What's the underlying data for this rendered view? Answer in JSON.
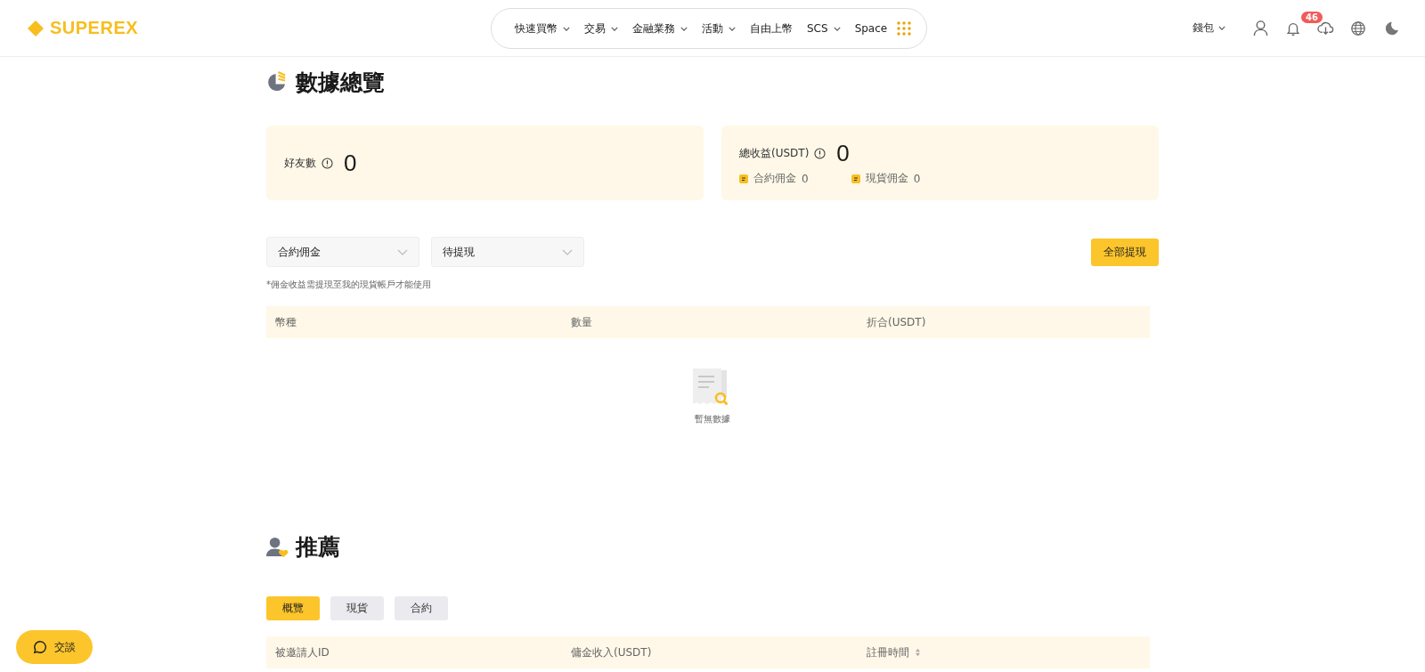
{
  "header": {
    "logo": "SUPEREX",
    "nav": [
      {
        "label": "快速買幣",
        "dropdown": true
      },
      {
        "label": "交易",
        "dropdown": true
      },
      {
        "label": "金融業務",
        "dropdown": true
      },
      {
        "label": "活動",
        "dropdown": true
      },
      {
        "label": "自由上幣",
        "dropdown": false
      },
      {
        "label": "SCS",
        "dropdown": true
      },
      {
        "label": "Space",
        "dropdown": false
      }
    ],
    "wallet": {
      "label": "錢包",
      "dropdown": true
    },
    "notification_count": "46"
  },
  "overview": {
    "title": "數據總覽",
    "friends": {
      "label": "好友數",
      "value": "0"
    },
    "earnings": {
      "label": "總收益(USDT)",
      "value": "0",
      "items": [
        {
          "label": "合約佣金",
          "value": "0"
        },
        {
          "label": "現貨佣金",
          "value": "0"
        }
      ]
    },
    "filters": [
      {
        "value": "合約佣金"
      },
      {
        "value": "待提現"
      }
    ],
    "withdraw_button": "全部提現",
    "note": "*佣金收益需提現至我的現貨帳戶才能使用",
    "table": {
      "columns": [
        "幣種",
        "數量",
        "折合(USDT)"
      ],
      "empty_text": "暫無數據"
    }
  },
  "referral": {
    "title": "推薦",
    "tabs": [
      {
        "label": "概覽",
        "selected": true
      },
      {
        "label": "現貨",
        "selected": false
      },
      {
        "label": "合約",
        "selected": false
      }
    ],
    "table": {
      "columns": [
        {
          "label": "被邀請人ID",
          "sortable": false
        },
        {
          "label": "傭金收入(USDT)",
          "sortable": false
        },
        {
          "label": "註冊時間",
          "sortable": true
        }
      ]
    }
  },
  "chat_button": "交談"
}
